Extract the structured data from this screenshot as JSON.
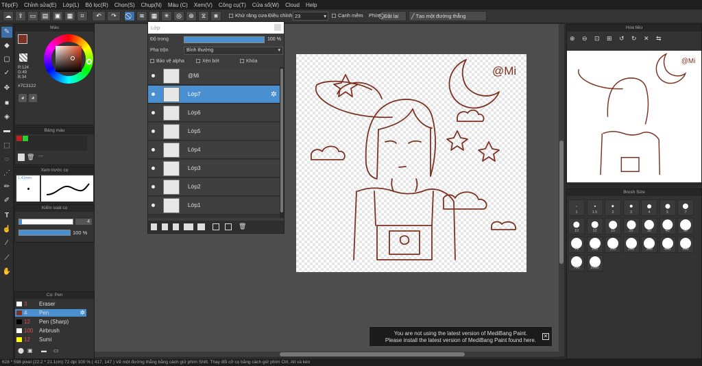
{
  "menu": [
    "Tệp(F)",
    "Chỉnh sửa(E)",
    "Lớp(L)",
    "Bộ lọc(R)",
    "Chọn(S)",
    "Chụp(N)",
    "Màu (C)",
    "Xem(V)",
    "Công cụ(T)",
    "Cửa sổ(W)",
    "Cloud",
    "Help"
  ],
  "toolbar": {
    "antialias_label": "Khử răng cưa",
    "adjust_label": "Điều chỉnh",
    "adjust_value": "23",
    "soft_edge_label": "Cạnh mềm",
    "key_label": "Phím",
    "off_label": "Đặt lại",
    "straight_line_label": "Tạo một đường thẳng"
  },
  "color_panel": {
    "title": "Màu",
    "rgb": [
      "R:124",
      "G:49",
      "B:34"
    ],
    "hex": "#7C3122",
    "main_color": "#7c3122"
  },
  "palette_panel": {
    "title": "Bảng màu",
    "footer": "---"
  },
  "brush_preview": {
    "title": "Xem trước cọ",
    "size_label": "1.41mm"
  },
  "brush_control": {
    "title": "Kiểm soát cọ",
    "size_value": "4",
    "opacity_value": "100 %"
  },
  "brush_list": {
    "title": "Cọ: Pen",
    "items": [
      {
        "size": "3",
        "name": "Eraser",
        "color": "#ffffff"
      },
      {
        "size": "4",
        "name": "Pen",
        "color": "#7c3122"
      },
      {
        "size": "12",
        "name": "Pen (Sharp)",
        "color": "#000000"
      },
      {
        "size": "100",
        "name": "Airbrush",
        "color": "#ffffff"
      },
      {
        "size": "12",
        "name": "Sumi",
        "color": "#ffff00"
      }
    ]
  },
  "layer_panel": {
    "title": "Lớp",
    "opacity_label": "Độ trong",
    "opacity_value": "100 %",
    "blend_label": "Pha trộn",
    "blend_value": "Bình thường",
    "protect_alpha": "Bảo vệ alpha",
    "clipping": "Xén bớt",
    "lock": "Khóa",
    "layers": [
      "@Mi",
      "Lớp7",
      "Lớp6",
      "Lớp5",
      "Lớp4",
      "Lớp3",
      "Lớp2",
      "Lớp1"
    ],
    "selected": "Lớp7"
  },
  "navigator": {
    "title": "Hoa tiêu"
  },
  "brush_size": {
    "title": "Brush Size",
    "sizes": [
      "1",
      "1.5",
      "2",
      "3",
      "4",
      "5",
      "7",
      "10",
      "12",
      "15",
      "20",
      "30",
      "40",
      "50",
      "70",
      "100",
      "150",
      "200",
      "300",
      "400",
      "500",
      "700",
      "1000"
    ]
  },
  "notice": {
    "line1": "You are not using the latest version of MediBang Paint.",
    "line2": "Please install the latest version of MediBang Paint found here."
  },
  "status": "628 * 598 pixel  (22.2 * 21.1cm)  72 dpi  100 %  ( 417, 147 )  Vẽ một đường thẳng bằng cách giữ phím Shift. Thay đổi cỡ cọ bằng cách giữ phím Ctrl, Alt và kéo",
  "canvas": {
    "signature": "@Mi",
    "line_color": "#7c3122"
  }
}
